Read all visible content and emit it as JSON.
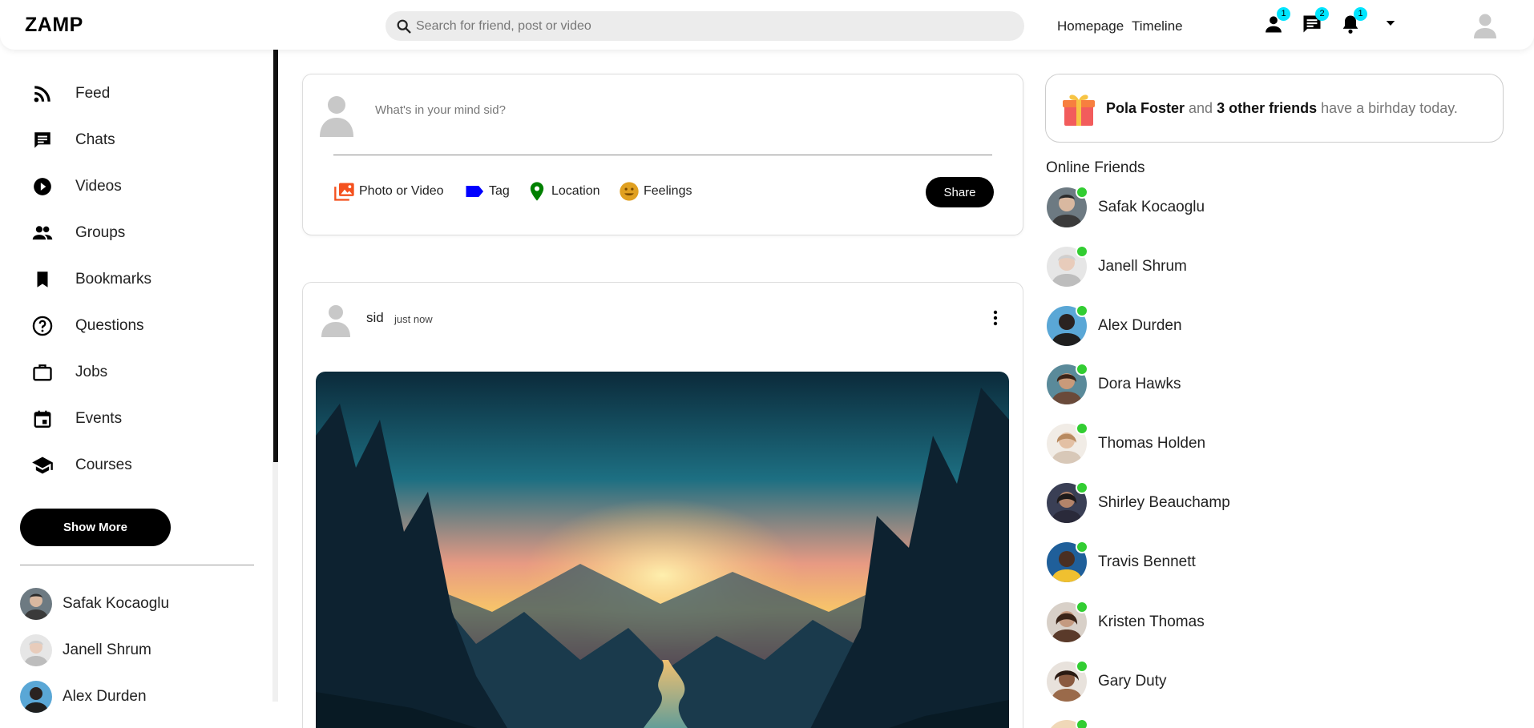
{
  "header": {
    "logo": "ZAMP",
    "search_placeholder": "Search for friend, post or video",
    "nav": [
      "Homepage",
      "Timeline"
    ],
    "badges": {
      "friends": "1",
      "messages": "2",
      "notifications": "1"
    }
  },
  "sidebar": {
    "items": [
      {
        "label": "Feed",
        "icon": "rss-icon"
      },
      {
        "label": "Chats",
        "icon": "chat-icon"
      },
      {
        "label": "Videos",
        "icon": "play-circle-icon"
      },
      {
        "label": "Groups",
        "icon": "group-icon"
      },
      {
        "label": "Bookmarks",
        "icon": "bookmark-icon"
      },
      {
        "label": "Questions",
        "icon": "question-icon"
      },
      {
        "label": "Jobs",
        "icon": "briefcase-icon"
      },
      {
        "label": "Events",
        "icon": "calendar-icon"
      },
      {
        "label": "Courses",
        "icon": "school-icon"
      }
    ],
    "show_more": "Show More",
    "friends": [
      "Safak Kocaoglu",
      "Janell Shrum",
      "Alex Durden"
    ]
  },
  "composer": {
    "prompt": "What's in your mind sid?",
    "options": [
      {
        "label": "Photo or Video",
        "icon": "photo-icon",
        "color": "#f4511e"
      },
      {
        "label": "Tag",
        "icon": "label-icon",
        "color": "#0000ff"
      },
      {
        "label": "Location",
        "icon": "location-pin-icon",
        "color": "#008000"
      },
      {
        "label": "Feelings",
        "icon": "emoji-icon",
        "color": "#e0a020"
      }
    ],
    "share": "Share"
  },
  "post": {
    "user": "sid",
    "time": "just now"
  },
  "birthday": {
    "name": "Pola Foster",
    "middle": " and ",
    "others": "3 other friends",
    "suffix": " have a birhday today."
  },
  "online": {
    "title": "Online Friends",
    "friends": [
      "Safak Kocaoglu",
      "Janell Shrum",
      "Alex Durden",
      "Dora Hawks",
      "Thomas Holden",
      "Shirley Beauchamp",
      "Travis Bennett",
      "Kristen Thomas",
      "Gary Duty"
    ]
  },
  "colors": {
    "online_dot": "#32cd32",
    "badge": "#00e5ff",
    "accent": "#000000"
  }
}
